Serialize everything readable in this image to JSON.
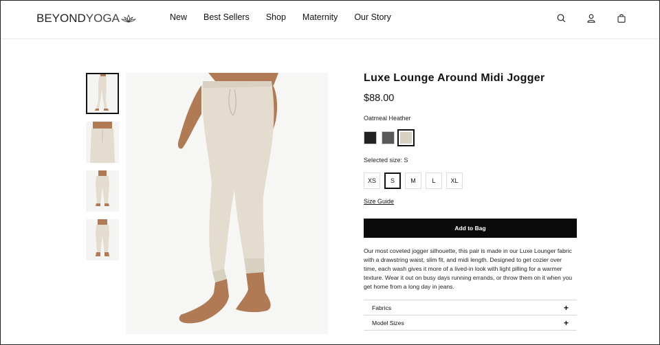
{
  "header": {
    "logo_main": "BEYOND",
    "logo_sub": "YOGA",
    "nav": [
      "New",
      "Best Sellers",
      "Shop",
      "Maternity",
      "Our Story"
    ],
    "icons": [
      "search-icon",
      "account-icon",
      "bag-icon"
    ]
  },
  "product": {
    "title": "Luxe Lounge Around Midi Jogger",
    "price": "$88.00",
    "color_name": "Oatmeal Heather",
    "swatches": [
      {
        "name": "black",
        "color": "#222222"
      },
      {
        "name": "charcoal",
        "color": "#5a5a5c"
      },
      {
        "name": "oatmeal",
        "color": "#d9d0c3"
      }
    ],
    "selected_size_label": "Selected size: S",
    "sizes": [
      "XS",
      "S",
      "M",
      "L",
      "XL"
    ],
    "selected_size": "S",
    "size_guide": "Size Guide",
    "add_to_bag": "Add to Bag",
    "description": "Our most coveted jogger silhouette, this pair is made in our Luxe Lounger fabric with a drawstring waist, slim fit, and midi length. Designed to get cozier over time, each wash gives it more of a lived-in look with light pilling for a warmer texture. Wear it out on busy days running errands, or throw them on it when you get home from a long day in jeans.",
    "accordion": [
      "Fabrics",
      "Model Sizes"
    ]
  },
  "colors": {
    "pant": "#e3dccf",
    "skin": "#b07a55",
    "bg": "#f6f6f5"
  }
}
